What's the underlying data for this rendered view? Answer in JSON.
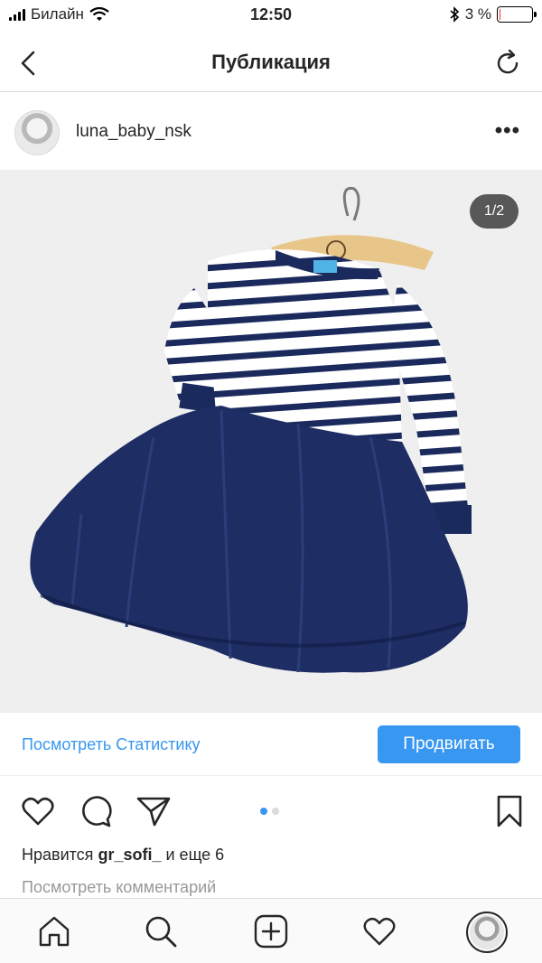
{
  "status_bar": {
    "carrier": "Билайн",
    "time": "12:50",
    "battery_percent": "3 %",
    "battery_level": 0.03,
    "icons": [
      "signal-icon",
      "wifi-icon",
      "bluetooth-icon",
      "battery-icon"
    ]
  },
  "nav": {
    "title": "Публикация",
    "back_icon": "chevron-left-icon",
    "refresh_icon": "refresh-icon"
  },
  "post": {
    "username": "luna_baby_nsk",
    "more_label": "•••",
    "image_counter": "1/2",
    "image_description_icon": "photo",
    "slide_index": 1,
    "slide_total": 2
  },
  "insights": {
    "view_insights_label": "Посмотреть Статистику",
    "promote_label": "Продвигать"
  },
  "likes": {
    "prefix": "Нравится",
    "user": "gr_sofi_",
    "suffix": "и еще 6"
  },
  "comments": {
    "view_label": "Посмотреть комментарий"
  },
  "tab_bar": {
    "items": [
      "home-icon",
      "search-icon",
      "add-icon",
      "activity-icon",
      "profile-avatar"
    ]
  },
  "colors": {
    "accent": "#3897f0",
    "text": "#262626",
    "muted": "#999999",
    "navy": "#1b2a5c"
  }
}
